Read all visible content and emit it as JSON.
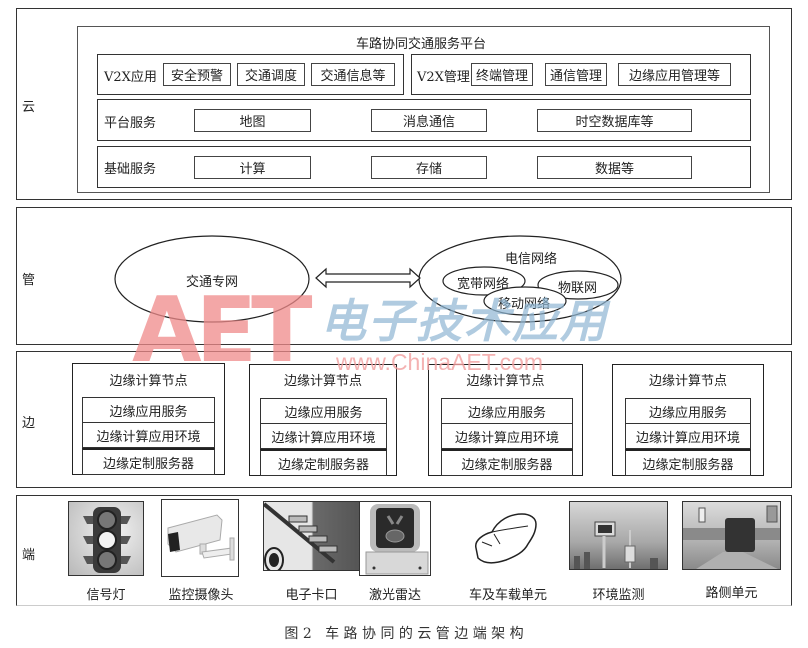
{
  "layers": {
    "cloud": {
      "label": "云",
      "platform_title": "车路协同交通服务平台",
      "v2x_app": {
        "label": "V2X应用",
        "items": [
          "安全预警",
          "交通调度",
          "交通信息等"
        ]
      },
      "v2x_mgmt": {
        "label": "V2X管理",
        "items": [
          "终端管理",
          "通信管理",
          "边缘应用管理等"
        ]
      },
      "platform_service": {
        "label": "平台服务",
        "items": [
          "地图",
          "消息通信",
          "时空数据库等"
        ]
      },
      "base_service": {
        "label": "基础服务",
        "items": [
          "计算",
          "存储",
          "数据等"
        ]
      }
    },
    "pipe": {
      "label": "管",
      "traffic_network": "交通专网",
      "telecom_network": {
        "label": "电信网络",
        "sub": [
          "宽带网络",
          "物联网",
          "移动网络"
        ]
      }
    },
    "edge": {
      "label": "边",
      "nodes": [
        {
          "title": "边缘计算节点",
          "rows": [
            "边缘应用服务",
            "边缘计算应用环境",
            "边缘定制服务器"
          ]
        },
        {
          "title": "边缘计算节点",
          "rows": [
            "边缘应用服务",
            "边缘计算应用环境",
            "边缘定制服务器"
          ]
        },
        {
          "title": "边缘计算节点",
          "rows": [
            "边缘应用服务",
            "边缘计算应用环境",
            "边缘定制服务器"
          ]
        },
        {
          "title": "边缘计算节点",
          "rows": [
            "边缘应用服务",
            "边缘计算应用环境",
            "边缘定制服务器"
          ]
        }
      ]
    },
    "terminal": {
      "label": "端",
      "devices": [
        {
          "name": "信号灯",
          "icon": "traffic-light-icon"
        },
        {
          "name": "监控摄像头",
          "icon": "surveillance-camera-icon"
        },
        {
          "name": "电子卡口",
          "icon": "electronic-checkpoint-icon"
        },
        {
          "name": "激光雷达",
          "icon": "lidar-icon"
        },
        {
          "name": "车及车载单元",
          "icon": "car-icon"
        },
        {
          "name": "环境监测",
          "icon": "environment-monitor-icon"
        },
        {
          "name": "路侧单元",
          "icon": "roadside-unit-icon"
        }
      ]
    }
  },
  "caption": "图 2   车 路 协 同 的 云 管 边 端 架 构",
  "watermark": {
    "logo": "AET",
    "chinese": "电子技术应用",
    "url": "www.ChinaAET.com",
    "colors": {
      "logo": "#f08a8a",
      "chinese": "#8fb6d3",
      "url": "#f2a0a0"
    }
  }
}
